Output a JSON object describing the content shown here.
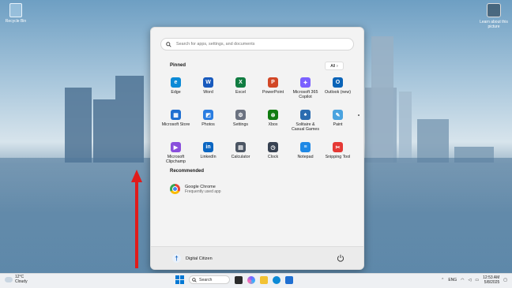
{
  "desktop": {
    "recycle_bin_label": "Recycle Bin",
    "learn_label": "Learn about this picture"
  },
  "start": {
    "search_placeholder": "Search for apps, settings, and documents",
    "pinned_header": "Pinned",
    "all_button": "All",
    "apps": [
      {
        "label": "Edge",
        "icon": "edge-icon",
        "color": "#0c8ad6",
        "glyph": "e"
      },
      {
        "label": "Word",
        "icon": "word-icon",
        "color": "#185abd",
        "glyph": "W"
      },
      {
        "label": "Excel",
        "icon": "excel-icon",
        "color": "#107c41",
        "glyph": "X"
      },
      {
        "label": "PowerPoint",
        "icon": "powerpoint-icon",
        "color": "#d24726",
        "glyph": "P"
      },
      {
        "label": "Microsoft 365 Copilot",
        "icon": "copilot-icon",
        "color": "#7b61ff",
        "glyph": "✦"
      },
      {
        "label": "Outlook (new)",
        "icon": "outlook-icon",
        "color": "#0a64b8",
        "glyph": "O"
      },
      {
        "label": "Microsoft Store",
        "icon": "store-icon",
        "color": "#1f6fd1",
        "glyph": "▦"
      },
      {
        "label": "Photos",
        "icon": "photos-icon",
        "color": "#2a7de1",
        "glyph": "◩"
      },
      {
        "label": "Settings",
        "icon": "settings-icon",
        "color": "#6b7280",
        "glyph": "⚙"
      },
      {
        "label": "Xbox",
        "icon": "xbox-icon",
        "color": "#107c10",
        "glyph": "⊗"
      },
      {
        "label": "Solitaire & Casual Games",
        "icon": "solitaire-icon",
        "color": "#2b6cb0",
        "glyph": "♠"
      },
      {
        "label": "Paint",
        "icon": "paint-icon",
        "color": "#4aa3df",
        "glyph": "✎"
      },
      {
        "label": "Microsoft Clipchamp",
        "icon": "clipchamp-icon",
        "color": "#8a4fdc",
        "glyph": "▶"
      },
      {
        "label": "LinkedIn",
        "icon": "linkedin-icon",
        "color": "#0a66c2",
        "glyph": "in"
      },
      {
        "label": "Calculator",
        "icon": "calculator-icon",
        "color": "#4b5563",
        "glyph": "▤"
      },
      {
        "label": "Clock",
        "icon": "clock-icon",
        "color": "#374151",
        "glyph": "◷"
      },
      {
        "label": "Notepad",
        "icon": "notepad-icon",
        "color": "#1e88e5",
        "glyph": "≡"
      },
      {
        "label": "Snipping Tool",
        "icon": "snipping-tool-icon",
        "color": "#e53935",
        "glyph": "✂"
      }
    ],
    "recommended_header": "Recommended",
    "recommended": [
      {
        "title": "Google Chrome",
        "subtitle": "Frequently used app"
      }
    ],
    "user_name": "Digital Citizen"
  },
  "taskbar": {
    "weather_temp": "12°C",
    "weather_desc": "Cloudy",
    "search_label": "Search",
    "language": "ENG",
    "time": "12:53 AM",
    "date": "5/8/2025"
  }
}
